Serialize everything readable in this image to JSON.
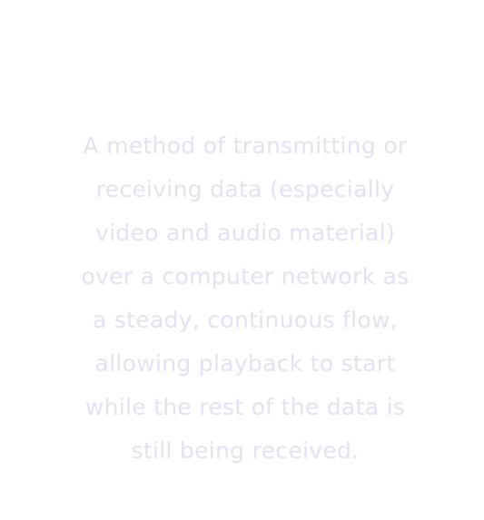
{
  "definition": {
    "lines": [
      "A method of transmitting or",
      "receiving data (especially",
      "video and audio material)",
      "over a computer network as",
      "a steady, continuous flow,",
      "allowing playback to start",
      "while the rest of the data is",
      "still being received."
    ],
    "text_color": "#f2f2fb"
  }
}
